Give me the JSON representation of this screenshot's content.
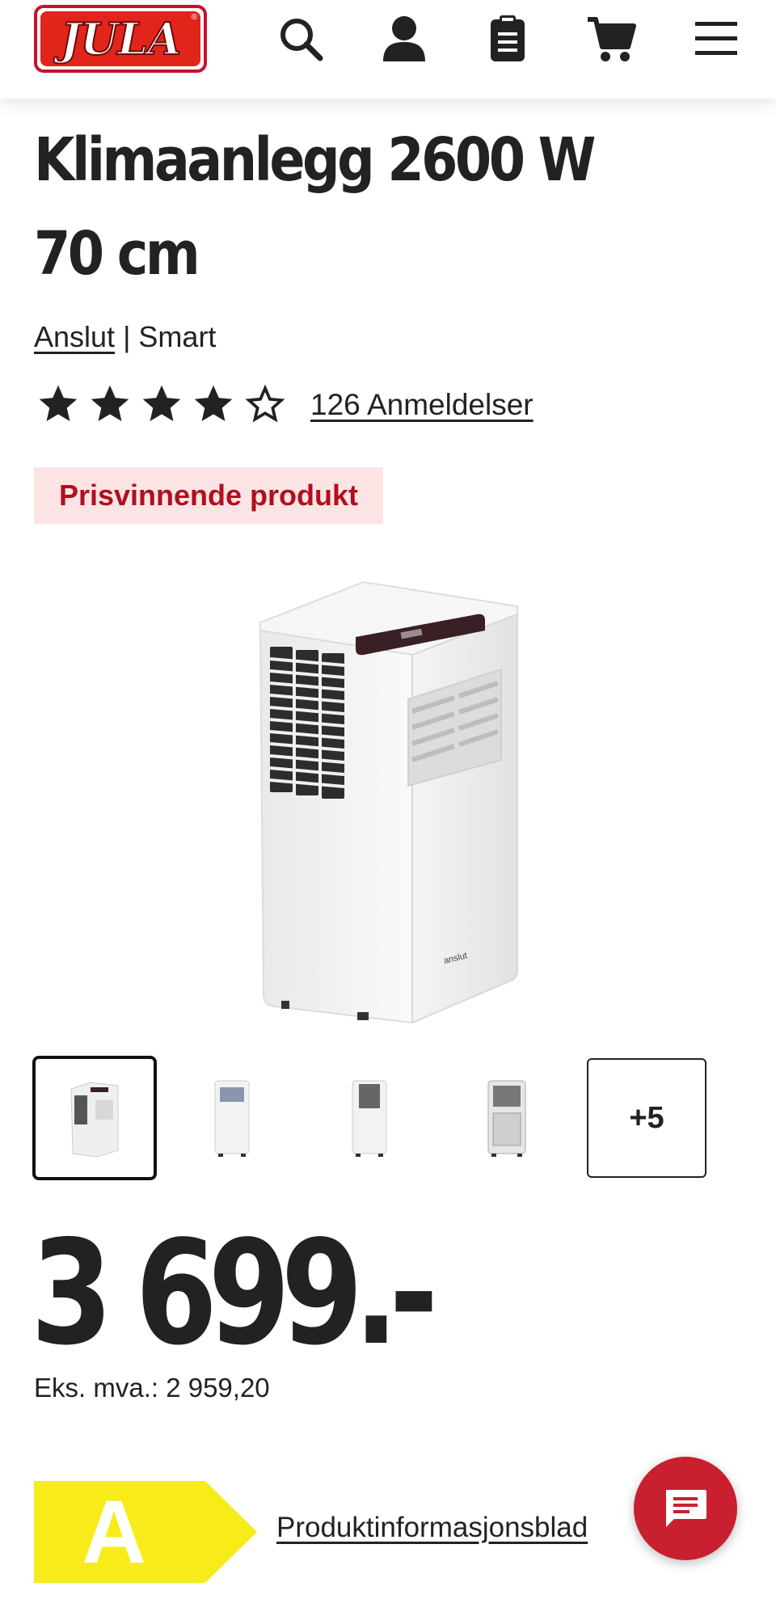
{
  "header": {
    "logo_text": "JULA",
    "logo_reg": "®",
    "icons": [
      "search-icon",
      "account-icon",
      "shopping-list-icon",
      "cart-icon",
      "menu-icon"
    ]
  },
  "product": {
    "title": "Klimaanlegg 2600 W 70 cm",
    "brand_link": "Anslut",
    "brand_separator": " | ",
    "brand_suffix": "Smart",
    "rating": {
      "value": 4,
      "max": 5
    },
    "reviews_label": "126 Anmeldelser",
    "badge": "Prisvinnende produkt",
    "image_caption": "anslut",
    "gallery": {
      "thumb_count": 4,
      "more_label": "+5"
    },
    "price": "3 699.-",
    "ex_vat": "Eks. mva.: 2 959,20",
    "energy_class": "A",
    "product_sheet_link": "Produktinformasjonsblad"
  },
  "colors": {
    "brand_red": "#e1251b",
    "badge_bg": "#fde4e4",
    "badge_text": "#b0101e",
    "energy_yellow": "#f7ec1a",
    "chat_red": "#c8202e"
  }
}
